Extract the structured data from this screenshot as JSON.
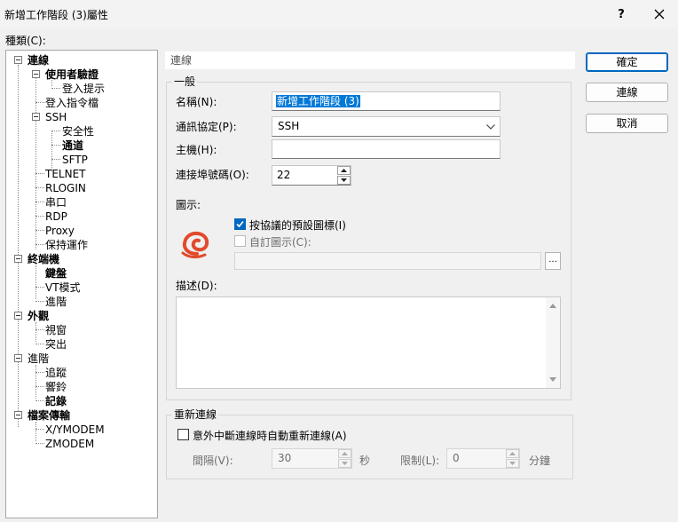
{
  "window": {
    "title": "新增工作階段 (3)屬性",
    "help_label": "?",
    "colors": {
      "accent": "#0067c0",
      "selection": "#0078d7",
      "background": "#f0f0f0"
    }
  },
  "category": {
    "label": "種類(C):",
    "tree": [
      {
        "label": "連線",
        "bold": true,
        "level": 0,
        "expanded": true
      },
      {
        "label": "使用者驗證",
        "bold": true,
        "level": 1,
        "expanded": true
      },
      {
        "label": "登入提示",
        "bold": false,
        "level": 2
      },
      {
        "label": "登入指令檔",
        "bold": false,
        "level": 1
      },
      {
        "label": "SSH",
        "bold": false,
        "level": 1,
        "expanded": true
      },
      {
        "label": "安全性",
        "bold": false,
        "level": 2
      },
      {
        "label": "通道",
        "bold": true,
        "level": 2
      },
      {
        "label": "SFTP",
        "bold": false,
        "level": 2
      },
      {
        "label": "TELNET",
        "bold": false,
        "level": 1
      },
      {
        "label": "RLOGIN",
        "bold": false,
        "level": 1
      },
      {
        "label": "串口",
        "bold": false,
        "level": 1
      },
      {
        "label": "RDP",
        "bold": false,
        "level": 1
      },
      {
        "label": "Proxy",
        "bold": false,
        "level": 1
      },
      {
        "label": "保持運作",
        "bold": false,
        "level": 1
      },
      {
        "label": "終端機",
        "bold": true,
        "level": 0,
        "expanded": true
      },
      {
        "label": "鍵盤",
        "bold": true,
        "level": 1
      },
      {
        "label": "VT模式",
        "bold": false,
        "level": 1
      },
      {
        "label": "進階",
        "bold": false,
        "level": 1
      },
      {
        "label": "外觀",
        "bold": true,
        "level": 0,
        "expanded": true
      },
      {
        "label": "視窗",
        "bold": false,
        "level": 1
      },
      {
        "label": "突出",
        "bold": false,
        "level": 1
      },
      {
        "label": "進階",
        "bold": false,
        "level": 0,
        "expanded": true
      },
      {
        "label": "追蹤",
        "bold": false,
        "level": 1
      },
      {
        "label": "響鈴",
        "bold": false,
        "level": 1
      },
      {
        "label": "記錄",
        "bold": true,
        "level": 1
      },
      {
        "label": "檔案傳輸",
        "bold": true,
        "level": 0,
        "expanded": true
      },
      {
        "label": "X/YMODEM",
        "bold": false,
        "level": 1
      },
      {
        "label": "ZMODEM",
        "bold": false,
        "level": 1
      }
    ]
  },
  "section": {
    "header": "連線"
  },
  "general": {
    "legend": "一般",
    "name_label": "名稱(N):",
    "name_value": "新增工作階段 (3)",
    "protocol_label": "通訊協定(P):",
    "protocol_value": "SSH",
    "host_label": "主機(H):",
    "host_value": "",
    "port_label": "連接埠號碼(O):",
    "port_value": "22",
    "icon_label": "圖示:",
    "default_icon_label": "按協議的預設圖標(I)",
    "default_icon_checked": true,
    "custom_icon_label": "自訂圖示(C):",
    "custom_icon_checked": false,
    "custom_icon_path": "",
    "browse_label": "...",
    "description_label": "描述(D):",
    "description_value": ""
  },
  "reconnect": {
    "legend": "重新連線",
    "auto_label": "意外中斷連線時自動重新連線(A)",
    "auto_checked": false,
    "interval_label": "間隔(V):",
    "interval_value": "30",
    "interval_unit": "秒",
    "limit_label": "限制(L):",
    "limit_value": "0",
    "limit_unit": "分鐘"
  },
  "buttons": {
    "ok": "確定",
    "connect": "連線",
    "cancel": "取消"
  }
}
